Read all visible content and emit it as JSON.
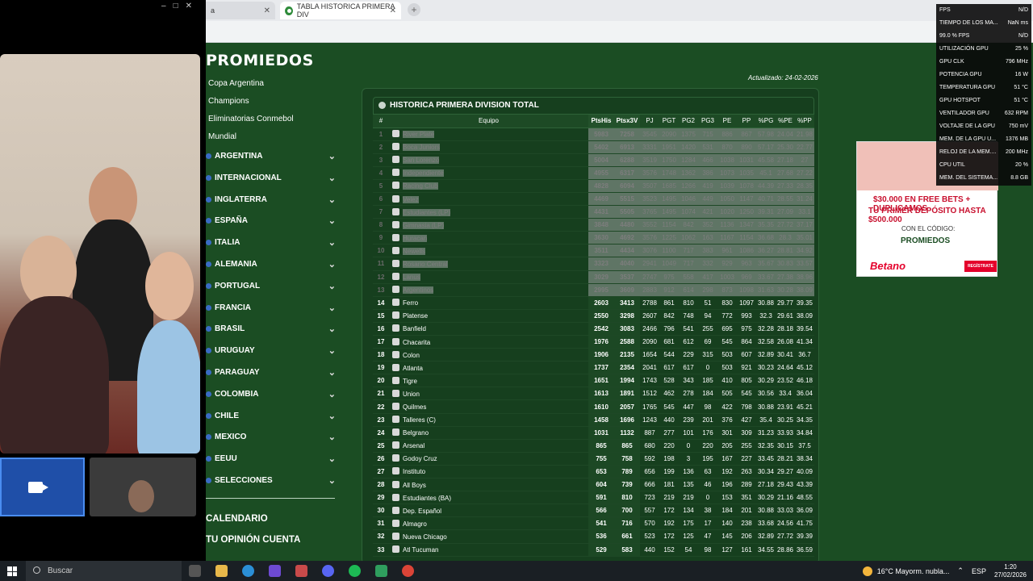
{
  "browser": {
    "tabs": [
      {
        "label": "a",
        "active": false
      },
      {
        "label": "TABLA HISTORICA PRIMERA DIV",
        "active": true
      }
    ]
  },
  "site": {
    "logo": "PROMIEDOS",
    "updated": "Actualizado: 24-02-2026",
    "competitions": [
      "Copa Argentina",
      "Champions",
      "Eliminatorias Conmebol",
      "Mundial"
    ],
    "countries": [
      "ARGENTINA",
      "INTERNACIONAL",
      "INGLATERRA",
      "ESPAÑA",
      "ITALIA",
      "ALEMANIA",
      "PORTUGAL",
      "FRANCIA",
      "BRASIL",
      "URUGUAY",
      "PARAGUAY",
      "COLOMBIA",
      "CHILE",
      "MEXICO",
      "EEUU",
      "SELECCIONES"
    ],
    "bottom_links": [
      "CALENDARIO",
      "TU OPINIÓN CUENTA"
    ],
    "table_title": "HISTORICA PRIMERA DIVISION TOTAL",
    "columns": [
      "#",
      "Equipo",
      "PtsHis",
      "Ptsx3V",
      "PJ",
      "PGT",
      "PG2",
      "PG3",
      "PE",
      "PP",
      "%PG",
      "%PE",
      "%PP"
    ],
    "rows": [
      [
        "1",
        "River Plate",
        "5983",
        "7258",
        "3545",
        "2090",
        "1375",
        "715",
        "886",
        "867",
        "57.98",
        "24.04",
        "21.98"
      ],
      [
        "2",
        "Boca Juniors",
        "5402",
        "6913",
        "3331",
        "1951",
        "1420",
        "531",
        "870",
        "890",
        "57.17",
        "25.30",
        "22.77"
      ],
      [
        "3",
        "San Lorenzo",
        "5004",
        "6288",
        "3519",
        "1750",
        "1284",
        "466",
        "1038",
        "1031",
        "45.58",
        "27.18",
        "27"
      ],
      [
        "4",
        "Independiente",
        "4955",
        "6317",
        "3576",
        "1748",
        "1362",
        "386",
        "1073",
        "1035",
        "45.1",
        "27.68",
        "27.22"
      ],
      [
        "5",
        "Racing Club",
        "4828",
        "6094",
        "3507",
        "1685",
        "1266",
        "419",
        "1039",
        "1078",
        "44.39",
        "27.33",
        "28.35"
      ],
      [
        "6",
        "Velez",
        "4469",
        "5515",
        "3523",
        "1495",
        "1046",
        "449",
        "1050",
        "1147",
        "40.71",
        "28.55",
        "31.24"
      ],
      [
        "7",
        "Estudiantes (LP)",
        "4431",
        "5505",
        "3765",
        "1495",
        "1074",
        "421",
        "1020",
        "1250",
        "39.31",
        "27.09",
        "33.1"
      ],
      [
        "8",
        "Gimnasia (LP)",
        "3848",
        "4480",
        "3552",
        "1154",
        "842",
        "352",
        "1136",
        "1347",
        "35.35",
        "27.72",
        "37.17"
      ],
      [
        "9",
        "Huracan",
        "3630",
        "4692",
        "3576",
        "1225",
        "1062",
        "163",
        "1167",
        "1154",
        "36.68",
        "28.3",
        "35.01"
      ],
      [
        "10",
        "Newells",
        "3511",
        "4434",
        "3076",
        "1100",
        "717",
        "383",
        "961",
        "1086",
        "36.27",
        "28.81",
        "34.92"
      ],
      [
        "11",
        "Rosario Central",
        "3323",
        "4040",
        "2941",
        "1049",
        "717",
        "332",
        "929",
        "963",
        "35.67",
        "30.83",
        "33.57"
      ],
      [
        "12",
        "Lanus",
        "3029",
        "3537",
        "2747",
        "975",
        "558",
        "417",
        "1003",
        "969",
        "33.67",
        "27.38",
        "38.96"
      ],
      [
        "13",
        "Argentinos",
        "2995",
        "3609",
        "2883",
        "912",
        "614",
        "298",
        "873",
        "1098",
        "31.63",
        "30.28",
        "38.09"
      ],
      [
        "14",
        "Ferro",
        "2603",
        "3413",
        "2788",
        "861",
        "810",
        "51",
        "830",
        "1097",
        "30.88",
        "29.77",
        "39.35"
      ],
      [
        "15",
        "Platense",
        "2550",
        "3298",
        "2607",
        "842",
        "748",
        "94",
        "772",
        "993",
        "32.3",
        "29.61",
        "38.09"
      ],
      [
        "16",
        "Banfield",
        "2542",
        "3083",
        "2466",
        "796",
        "541",
        "255",
        "695",
        "975",
        "32.28",
        "28.18",
        "39.54"
      ],
      [
        "17",
        "Chacarita",
        "1976",
        "2588",
        "2090",
        "681",
        "612",
        "69",
        "545",
        "864",
        "32.58",
        "26.08",
        "41.34"
      ],
      [
        "18",
        "Colon",
        "1906",
        "2135",
        "1654",
        "544",
        "229",
        "315",
        "503",
        "607",
        "32.89",
        "30.41",
        "36.7"
      ],
      [
        "19",
        "Atlanta",
        "1737",
        "2354",
        "2041",
        "617",
        "617",
        "0",
        "503",
        "921",
        "30.23",
        "24.64",
        "45.12"
      ],
      [
        "20",
        "Tigre",
        "1651",
        "1994",
        "1743",
        "528",
        "343",
        "185",
        "410",
        "805",
        "30.29",
        "23.52",
        "46.18"
      ],
      [
        "21",
        "Union",
        "1613",
        "1891",
        "1512",
        "462",
        "278",
        "184",
        "505",
        "545",
        "30.56",
        "33.4",
        "36.04"
      ],
      [
        "22",
        "Quilmes",
        "1610",
        "2057",
        "1765",
        "545",
        "447",
        "98",
        "422",
        "798",
        "30.88",
        "23.91",
        "45.21"
      ],
      [
        "23",
        "Talleres (C)",
        "1458",
        "1696",
        "1243",
        "440",
        "239",
        "201",
        "376",
        "427",
        "35.4",
        "30.25",
        "34.35"
      ],
      [
        "24",
        "Belgrano",
        "1031",
        "1132",
        "887",
        "277",
        "101",
        "176",
        "301",
        "309",
        "31.23",
        "33.93",
        "34.84"
      ],
      [
        "25",
        "Arsenal",
        "865",
        "865",
        "680",
        "220",
        "0",
        "220",
        "205",
        "255",
        "32.35",
        "30.15",
        "37.5"
      ],
      [
        "26",
        "Godoy Cruz",
        "755",
        "758",
        "592",
        "198",
        "3",
        "195",
        "167",
        "227",
        "33.45",
        "28.21",
        "38.34"
      ],
      [
        "27",
        "Instituto",
        "653",
        "789",
        "656",
        "199",
        "136",
        "63",
        "192",
        "263",
        "30.34",
        "29.27",
        "40.09"
      ],
      [
        "28",
        "All Boys",
        "604",
        "739",
        "666",
        "181",
        "135",
        "46",
        "196",
        "289",
        "27.18",
        "29.43",
        "43.39"
      ],
      [
        "29",
        "Estudiantes (BA)",
        "591",
        "810",
        "723",
        "219",
        "219",
        "0",
        "153",
        "351",
        "30.29",
        "21.16",
        "48.55"
      ],
      [
        "30",
        "Dep. Español",
        "566",
        "700",
        "557",
        "172",
        "134",
        "38",
        "184",
        "201",
        "30.88",
        "33.03",
        "36.09"
      ],
      [
        "31",
        "Almagro",
        "541",
        "716",
        "570",
        "192",
        "175",
        "17",
        "140",
        "238",
        "33.68",
        "24.56",
        "41.75"
      ],
      [
        "32",
        "Nueva Chicago",
        "536",
        "661",
        "523",
        "172",
        "125",
        "47",
        "145",
        "206",
        "32.89",
        "27.72",
        "39.39"
      ],
      [
        "33",
        "Atl Tucuman",
        "529",
        "583",
        "440",
        "152",
        "54",
        "98",
        "127",
        "161",
        "34.55",
        "28.86",
        "36.59"
      ]
    ],
    "highlighted_rows": 13,
    "ad": {
      "line1": "$30.000 EN FREE BETS + DUPLICAMOS",
      "line2": "TU PRIMER DEPÓSITO HASTA $500.000",
      "line3": "CON EL CÓDIGO:",
      "code": "PROMIEDOS",
      "brand": "Betano",
      "cta": "REGÍSTRATE"
    }
  },
  "perf_overlay": [
    [
      "FPS",
      "N/D"
    ],
    [
      "TIEMPO DE LOS MA...",
      "NaN ms"
    ],
    [
      "99.0 % FPS",
      "N/D"
    ],
    [
      "UTILIZACIÓN GPU",
      "25 %"
    ],
    [
      "GPU CLK",
      "796 MHz"
    ],
    [
      "POTENCIA GPU",
      "16 W"
    ],
    [
      "TEMPERATURA GPU",
      "51 °C"
    ],
    [
      "GPU HOTSPOT",
      "51 °C"
    ],
    [
      "VENTILADOR GPU",
      "632 RPM"
    ],
    [
      "VOLTAJE DE LA GPU",
      "750 mV"
    ],
    [
      "MEM. DE LA GPU U...",
      "1376 MB"
    ],
    [
      "RELOJ DE LA MEM....",
      "200 MHz"
    ],
    [
      "CPU UTIL",
      "20 %"
    ],
    [
      "MEM. DEL SISTEMA...",
      "8.8 GB"
    ]
  ],
  "taskbar": {
    "search_placeholder": "Buscar",
    "weather": "16°C  Mayorm. nubla...",
    "lang": "ESP",
    "time": "1:20",
    "date": "27/02/2026"
  }
}
